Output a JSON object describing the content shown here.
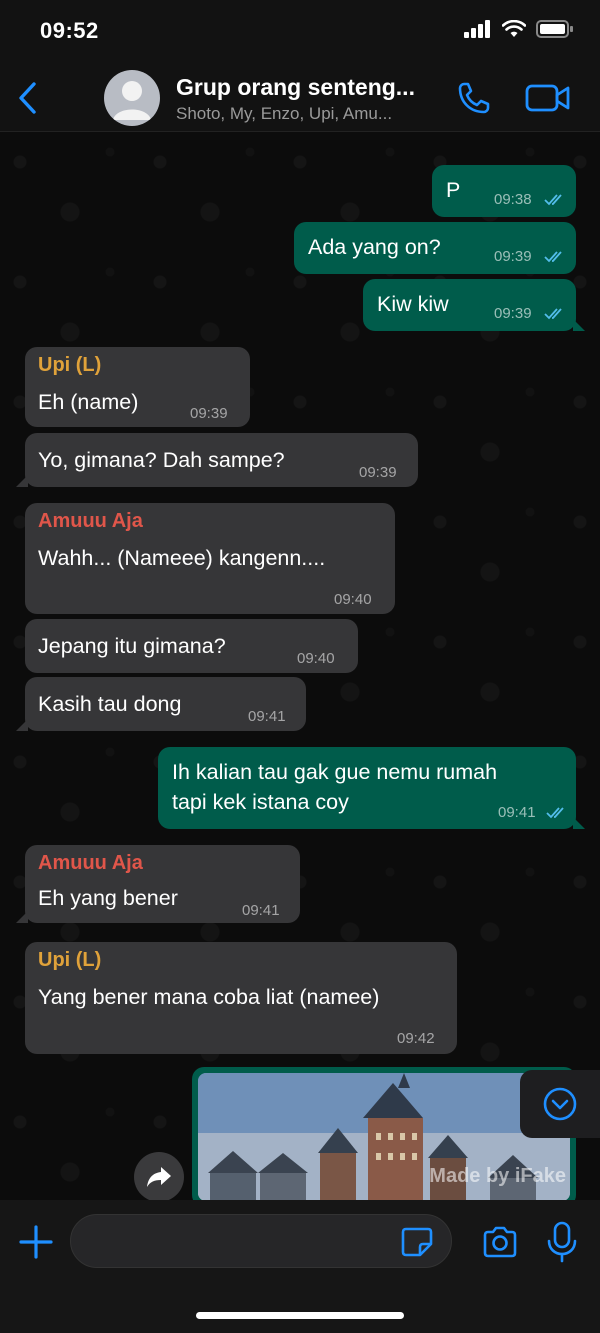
{
  "status_bar": {
    "time": "09:52"
  },
  "header": {
    "title": "Grup orang senteng...",
    "subtitle": "Shoto, My, Enzo, Upi, Amu..."
  },
  "colors": {
    "accent": "#1f8fff",
    "outgoing_bubble": "#005c4b",
    "incoming_bubble": "#363638",
    "sender_upi": "#e0a23a",
    "sender_amuuu": "#e0564a",
    "read_ticks": "#53bdeb"
  },
  "messages": [
    {
      "direction": "out",
      "text": "P",
      "time": "09:38",
      "read": true
    },
    {
      "direction": "out",
      "text": "Ada yang on?",
      "time": "09:39",
      "read": true
    },
    {
      "direction": "out",
      "text": "Kiw kiw",
      "time": "09:39",
      "read": true
    },
    {
      "direction": "in",
      "sender": "Upi (L)",
      "text": "Eh (name)",
      "time": "09:39"
    },
    {
      "direction": "in",
      "text": "Yo, gimana? Dah sampe?",
      "time": "09:39"
    },
    {
      "direction": "in",
      "sender": "Amuuu Aja",
      "text": "Wahh... (Nameee) kangenn....",
      "time": "09:40"
    },
    {
      "direction": "in",
      "text": "Jepang itu gimana?",
      "time": "09:40"
    },
    {
      "direction": "in",
      "text": "Kasih tau dong",
      "time": "09:41"
    },
    {
      "direction": "out",
      "text_line1": "Ih kalian tau gak gue nemu rumah",
      "text_line2": "tapi kek istana coy",
      "time": "09:41",
      "read": true
    },
    {
      "direction": "in",
      "sender": "Amuuu Aja",
      "text": "Eh yang bener",
      "time": "09:41"
    },
    {
      "direction": "in",
      "sender": "Upi (L)",
      "text": "Yang bener mana coba liat (namee)",
      "time": "09:42"
    }
  ],
  "image_message": {
    "watermark": "Made by iFake"
  },
  "icons": {
    "back": "chevron-left-icon",
    "call": "phone-icon",
    "video": "video-camera-icon",
    "forward": "share-arrow-icon",
    "scroll_down": "chevron-down-circle-icon",
    "plus": "plus-icon",
    "sticker": "sticker-icon",
    "camera": "camera-icon",
    "mic": "microphone-icon"
  }
}
